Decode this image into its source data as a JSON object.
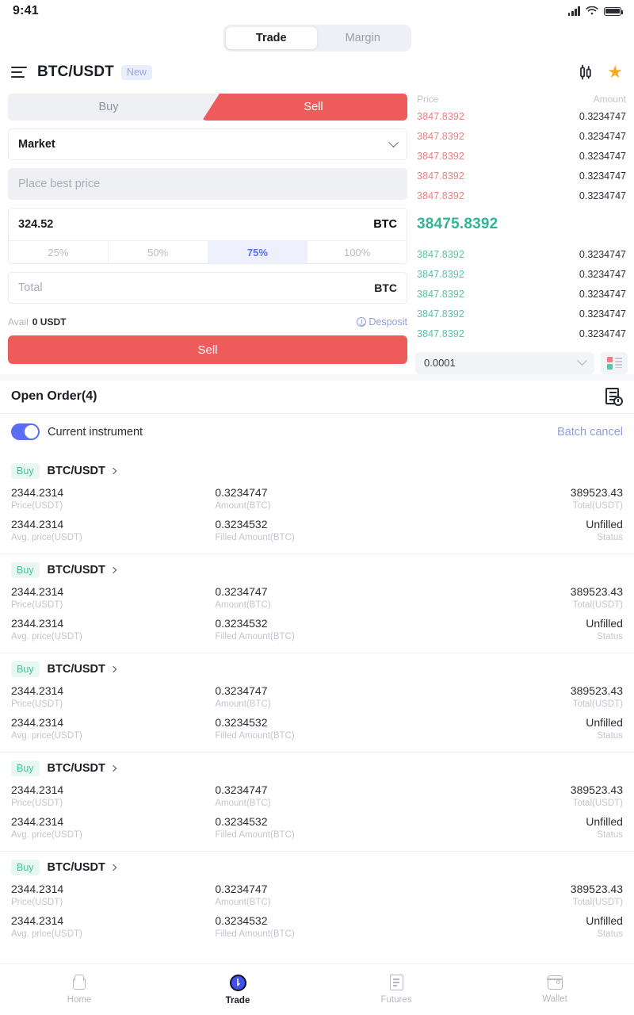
{
  "status_bar": {
    "time": "9:41",
    "signal_icon": "signal-icon",
    "wifi_icon": "wifi-icon",
    "battery_icon": "battery-icon"
  },
  "top_tabs": {
    "trade": "Trade",
    "margin": "Margin"
  },
  "pair_header": {
    "menu_icon": "hamburger-icon",
    "pair": "BTC/USDT",
    "badge": "New",
    "chart_icon": "candlestick-icon",
    "favorite_icon": "star-icon"
  },
  "order_form": {
    "buy_label": "Buy",
    "sell_label": "Sell",
    "order_type": "Market",
    "price_placeholder": "Place best price",
    "amount_value": "324.52",
    "amount_unit": "BTC",
    "percents": [
      "25%",
      "50%",
      "75%",
      "100%"
    ],
    "percent_active": "75%",
    "total_placeholder": "Total",
    "total_unit": "BTC",
    "avail_label": "Avail",
    "avail_value": "0 USDT",
    "deposit_label": "Desposit",
    "submit_label": "Sell",
    "accent_sell": "#ee5b5b",
    "accent_active_pct": "#5b6cf5"
  },
  "order_book": {
    "col_price": "Price",
    "col_amount": "Amount",
    "asks": [
      {
        "price": "3847.8392",
        "amount": "0.3234747"
      },
      {
        "price": "3847.8392",
        "amount": "0.3234747"
      },
      {
        "price": "3847.8392",
        "amount": "0.3234747"
      },
      {
        "price": "3847.8392",
        "amount": "0.3234747"
      },
      {
        "price": "3847.8392",
        "amount": "0.3234747"
      }
    ],
    "last_price": "38475.8392",
    "bids": [
      {
        "price": "3847.8392",
        "amount": "0.3234747"
      },
      {
        "price": "3847.8392",
        "amount": "0.3234747"
      },
      {
        "price": "3847.8392",
        "amount": "0.3234747"
      },
      {
        "price": "3847.8392",
        "amount": "0.3234747"
      },
      {
        "price": "3847.8392",
        "amount": "0.3234747"
      }
    ],
    "tick_size": "0.0001",
    "depth_icon": "depth-view-icon",
    "ask_color": "#ef8080",
    "bid_color": "#5bc2a5",
    "last_color": "#2fb795"
  },
  "open_orders": {
    "title": "Open Order(4)",
    "history_icon": "order-history-icon",
    "toggle_label": "Current instrument",
    "toggle_on": true,
    "batch_cancel": "Batch cancel",
    "labels": {
      "price": "Price(USDT)",
      "amount": "Amount(BTC)",
      "total": "Total(USDT)",
      "avg_price": "Avg. price(USDT)",
      "filled": "Filled Amount(BTC)",
      "status": "Status"
    },
    "rows": [
      {
        "side": "Buy",
        "pair": "BTC/USDT",
        "price": "2344.2314",
        "amount": "0.3234747",
        "total": "389523.43",
        "avg_price": "2344.2314",
        "filled": "0.3234532",
        "status": "Unfilled"
      },
      {
        "side": "Buy",
        "pair": "BTC/USDT",
        "price": "2344.2314",
        "amount": "0.3234747",
        "total": "389523.43",
        "avg_price": "2344.2314",
        "filled": "0.3234532",
        "status": "Unfilled"
      },
      {
        "side": "Buy",
        "pair": "BTC/USDT",
        "price": "2344.2314",
        "amount": "0.3234747",
        "total": "389523.43",
        "avg_price": "2344.2314",
        "filled": "0.3234532",
        "status": "Unfilled"
      },
      {
        "side": "Buy",
        "pair": "BTC/USDT",
        "price": "2344.2314",
        "amount": "0.3234747",
        "total": "389523.43",
        "avg_price": "2344.2314",
        "filled": "0.3234532",
        "status": "Unfilled"
      },
      {
        "side": "Buy",
        "pair": "BTC/USDT",
        "price": "2344.2314",
        "amount": "0.3234747",
        "total": "389523.43",
        "avg_price": "2344.2314",
        "filled": "0.3234532",
        "status": "Unfilled"
      }
    ]
  },
  "bottom_nav": {
    "items": [
      {
        "label": "Home",
        "icon": "home-icon",
        "active": false
      },
      {
        "label": "Trade",
        "icon": "trade-icon",
        "active": true
      },
      {
        "label": "Futures",
        "icon": "futures-icon",
        "active": false
      },
      {
        "label": "Wallet",
        "icon": "wallet-icon",
        "active": false
      }
    ]
  }
}
